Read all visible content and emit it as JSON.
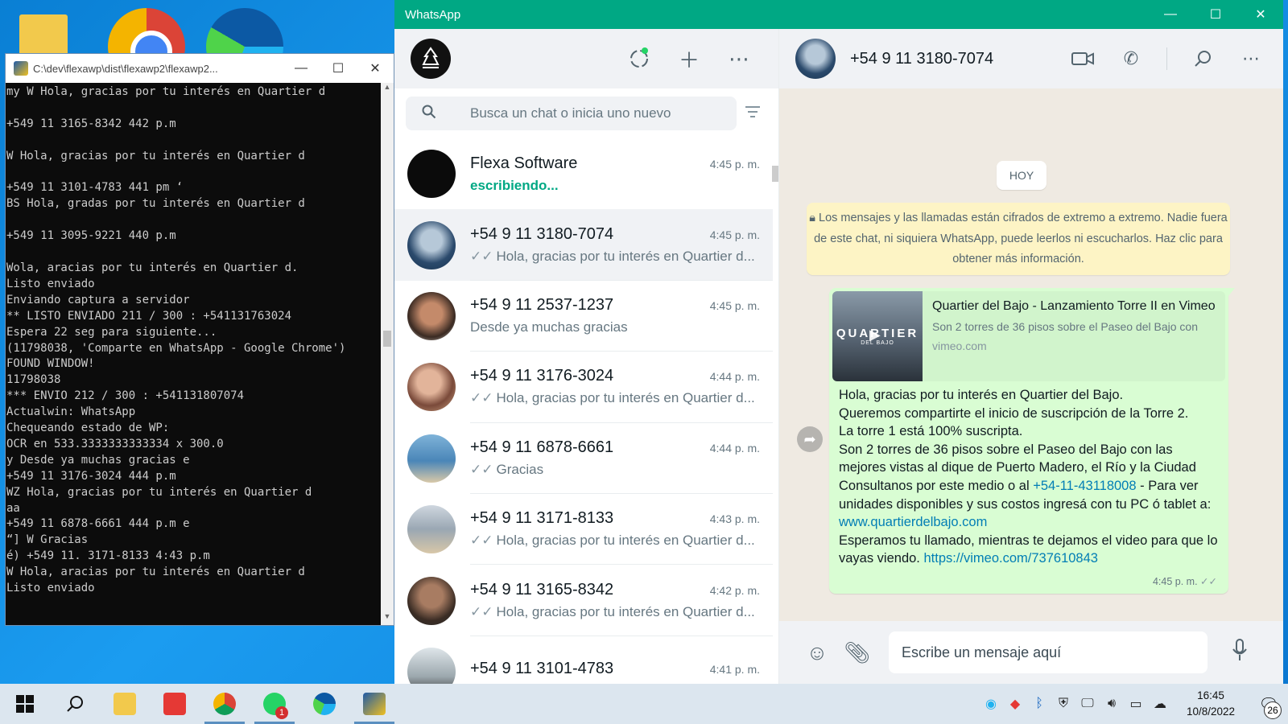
{
  "console": {
    "title": "C:\\dev\\flexawp\\dist\\flexawp2\\flexawp2...",
    "lines": "my W Hola, gracias por tu interés en Quartier d\n\n+549 11 3165-8342 442 p.m\n\nW Hola, gracias por tu interés en Quartier d\n\n+549 11 3101-4783 441 pm ‘\nBS Hola, gradas por tu interés en Quartier d\n\n+549 11 3095-9221 440 p.m\n\nWola, aracias por tu interés en Quartier d.\nListo enviado\nEnviando captura a servidor\n** LISTO ENVIADO 211 / 300 : +541131763024\nEspera 22 seg para siguiente...\n(11798038, 'Comparte en WhatsApp - Google Chrome')\nFOUND WINDOW!\n11798038\n*** ENVIO 212 / 300 : +541131807074\nActualwin: WhatsApp\nChequeando estado de WP:\nOCR en 533.3333333333334 x 300.0\ny Desde ya muchas gracias e\n+549 11 3176-3024 444 p.m\nWZ Hola, gracias por tu interés en Quartier d\naa\n+549 11 6878-6661 444 p.m e\n“] W Gracias\né) +549 11. 3171-8133 4:43 p.m\nW Hola, aracias por tu interés en Quartier d\nListo enviado"
  },
  "whatsapp": {
    "window_title": "WhatsApp",
    "search_placeholder": "Busca un chat o inicia uno nuevo",
    "chats": [
      {
        "name": "Flexa Software",
        "time": "4:45 p. m.",
        "preview": "escribiendo...",
        "typing": true
      },
      {
        "name": "+54 9 11 3180-7074",
        "time": "4:45 p. m.",
        "preview": "Hola, gracias por tu interés en Quartier d...",
        "tick": "✓✓"
      },
      {
        "name": "+54 9 11 2537-1237",
        "time": "4:45 p. m.",
        "preview": "Desde ya muchas gracias"
      },
      {
        "name": "+54 9 11 3176-3024",
        "time": "4:44 p. m.",
        "preview": "Hola, gracias por tu interés en Quartier d...",
        "tick": "✓✓"
      },
      {
        "name": "+54 9 11 6878-6661",
        "time": "4:44 p. m.",
        "preview": "Gracias",
        "tick": "✓✓"
      },
      {
        "name": "+54 9 11 3171-8133",
        "time": "4:43 p. m.",
        "preview": "Hola, gracias por tu interés en Quartier d...",
        "tick": "✓✓"
      },
      {
        "name": "+54 9 11 3165-8342",
        "time": "4:42 p. m.",
        "preview": "Hola, gracias por tu interés en Quartier d...",
        "tick": "✓✓"
      },
      {
        "name": "+54 9 11 3101-4783",
        "time": "4:41 p. m.",
        "preview": ""
      }
    ],
    "conversation": {
      "contact": "+54 9 11 3180-7074",
      "day_label": "HOY",
      "encryption_notice": "Los mensajes y las llamadas están cifrados de extremo a extremo. Nadie fuera de este chat, ni siquiera WhatsApp, puede leerlos ni escucharlos. Haz clic para obtener más información.",
      "link_preview": {
        "thumb_brand": "QUARTIER",
        "thumb_sub": "DEL BAJO",
        "title": "Quartier del Bajo - Lanzamiento Torre II en Vimeo",
        "description": "Son 2 torres de 36 pisos sobre el Paseo del Bajo con",
        "domain": "vimeo.com"
      },
      "message": {
        "line1": "Hola, gracias por tu interés en Quartier del Bajo.",
        "line2": "Queremos compartirte el inicio de suscripción de la Torre 2.",
        "line3": "La torre 1 está 100% suscripta.",
        "line4": "Son 2 torres de 36 pisos sobre el Paseo del Bajo con las mejores vistas al dique de Puerto Madero, el Río y la Ciudad",
        "line5_pre": "Consultanos por este medio o al ",
        "phone_link": "+54-11-43118008",
        "line5_post": " - Para ver unidades disponibles y sus costos ingresá con tu PC ó tablet a: ",
        "site_link": "www.quartierdelbajo.com",
        "line6_pre": "Esperamos tu llamado, mientras te dejamos el video para que lo vayas viendo. ",
        "video_link": "https://vimeo.com/737610843",
        "time": "4:45 p. m.",
        "tick": "✓✓"
      },
      "composer_placeholder": "Escribe un mensaje aquí"
    }
  },
  "taskbar": {
    "whatsapp_badge": "1",
    "clock_time": "16:45",
    "clock_date": "10/8/2022",
    "notifications_count": "26"
  }
}
